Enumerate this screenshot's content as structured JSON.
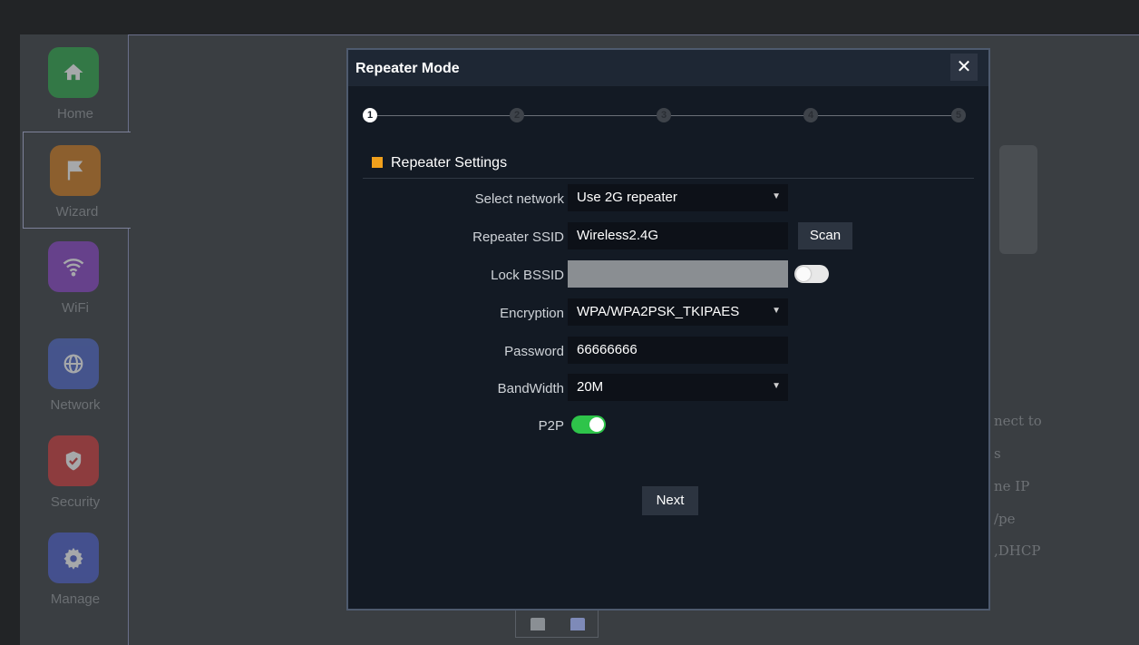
{
  "sidebar": {
    "items": [
      {
        "label": "Home",
        "icon": "home-icon",
        "color": "#2fa84a"
      },
      {
        "label": "Wizard",
        "icon": "flag-icon",
        "color": "#d07a1e"
      },
      {
        "label": "WiFi",
        "icon": "wifi-icon",
        "color": "#8a45c7"
      },
      {
        "label": "Network",
        "icon": "globe-icon",
        "color": "#4f67c9"
      },
      {
        "label": "Security",
        "icon": "shield-icon",
        "color": "#d23b3b"
      },
      {
        "label": "Manage",
        "icon": "gear-icon",
        "color": "#4d5fcc"
      }
    ],
    "active": "Wizard"
  },
  "background": {
    "fragments": [
      "nect to",
      "s",
      "ne IP",
      "/pe",
      ",DHCP"
    ]
  },
  "modal": {
    "title": "Repeater Mode",
    "close_label": "✕",
    "steps": [
      "1",
      "2",
      "3",
      "4",
      "5"
    ],
    "current_step": 1,
    "section_title": "Repeater Settings",
    "accent_color": "#f0a01c",
    "fields": {
      "select_network": {
        "label": "Select network",
        "value": "Use 2G repeater"
      },
      "repeater_ssid": {
        "label": "Repeater SSID",
        "value": "Wireless2.4G",
        "button": "Scan"
      },
      "lock_bssid": {
        "label": "Lock BSSID",
        "value": "",
        "toggle": "off"
      },
      "encryption": {
        "label": "Encryption",
        "value": "WPA/WPA2PSK_TKIPAES"
      },
      "password": {
        "label": "Password",
        "value": "66666666"
      },
      "bandwidth": {
        "label": "BandWidth",
        "value": "20M"
      },
      "p2p": {
        "label": "P2P",
        "toggle": "on"
      }
    },
    "next_label": "Next"
  }
}
